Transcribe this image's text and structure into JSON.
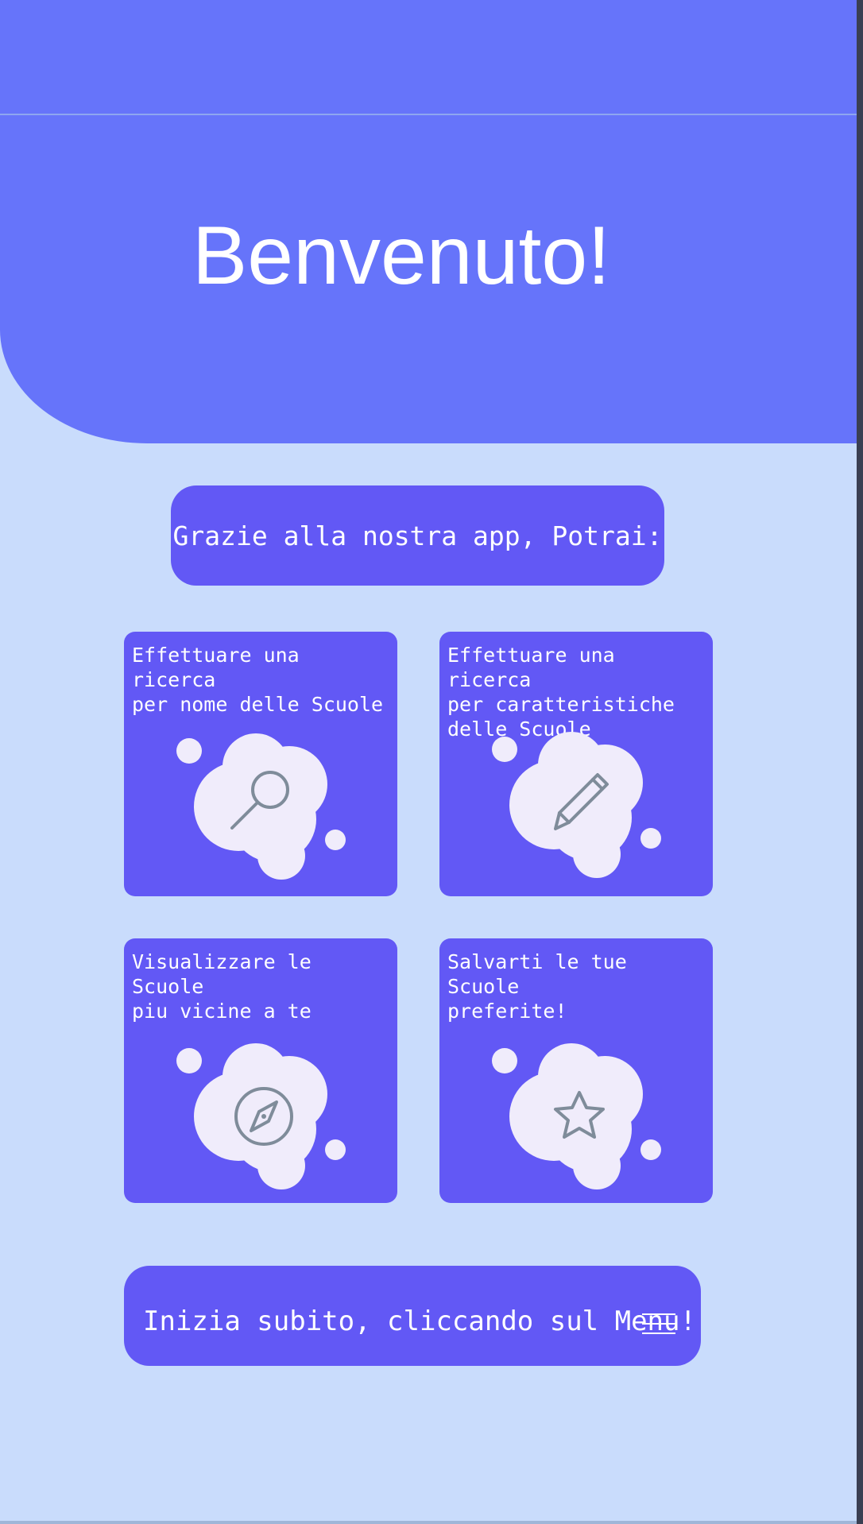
{
  "header": {
    "title": "Benvenuto!"
  },
  "intro": {
    "label": "Grazie alla nostra app, Potrai:"
  },
  "features": [
    {
      "text": "Effettuare una ricerca\nper nome delle Scuole",
      "icon": "search-icon"
    },
    {
      "text": "Effettuare una ricerca\nper caratteristiche\ndelle Scuole",
      "icon": "pencil-icon"
    },
    {
      "text": "Visualizzare le Scuole\npiu vicine a te",
      "icon": "compass-icon"
    },
    {
      "text": "Salvarti le tue Scuole\npreferite!",
      "icon": "star-icon"
    }
  ],
  "cta": {
    "label": "Inizia subito, cliccando sul Menu!",
    "icon": "menu-icon"
  },
  "colors": {
    "header": "#6674fa",
    "background": "#c9dcfc",
    "card": "#6258f5",
    "cloud": "#f0ecfb",
    "icon_stroke": "#7f8c9a"
  }
}
